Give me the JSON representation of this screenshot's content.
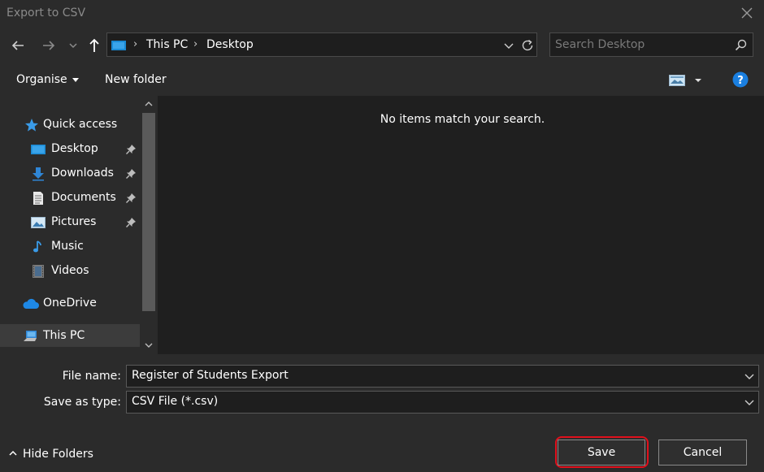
{
  "window": {
    "title": "Export to CSV"
  },
  "address": {
    "crumbs": [
      "This PC",
      "Desktop"
    ]
  },
  "search": {
    "placeholder": "Search Desktop"
  },
  "toolbar": {
    "organise_label": "Organise",
    "new_folder_label": "New folder"
  },
  "nav": {
    "items": [
      {
        "label": "Quick access",
        "icon": "star-icon",
        "pinned": false
      },
      {
        "label": "Desktop",
        "icon": "desktop-icon",
        "pinned": true
      },
      {
        "label": "Downloads",
        "icon": "download-icon",
        "pinned": true
      },
      {
        "label": "Documents",
        "icon": "document-icon",
        "pinned": true
      },
      {
        "label": "Pictures",
        "icon": "pictures-icon",
        "pinned": true
      },
      {
        "label": "Music",
        "icon": "music-note-icon",
        "pinned": false
      },
      {
        "label": "Videos",
        "icon": "video-icon",
        "pinned": false
      },
      {
        "label": "OneDrive",
        "icon": "cloud-icon",
        "pinned": false
      },
      {
        "label": "This PC",
        "icon": "computer-icon",
        "pinned": false,
        "selected": true
      }
    ]
  },
  "content": {
    "empty_message": "No items match your search."
  },
  "form": {
    "file_name_label": "File name:",
    "file_name_value": "Register of Students Export",
    "save_type_label": "Save as type:",
    "save_type_value": "CSV File (*.csv)"
  },
  "footer": {
    "hide_folders_label": "Hide Folders",
    "save_label": "Save",
    "cancel_label": "Cancel"
  },
  "colors": {
    "accent": "#1a8ad4",
    "highlight_ring": "#e0101c",
    "background": "#2b2b2b",
    "content_bg": "#1f1f1f"
  }
}
